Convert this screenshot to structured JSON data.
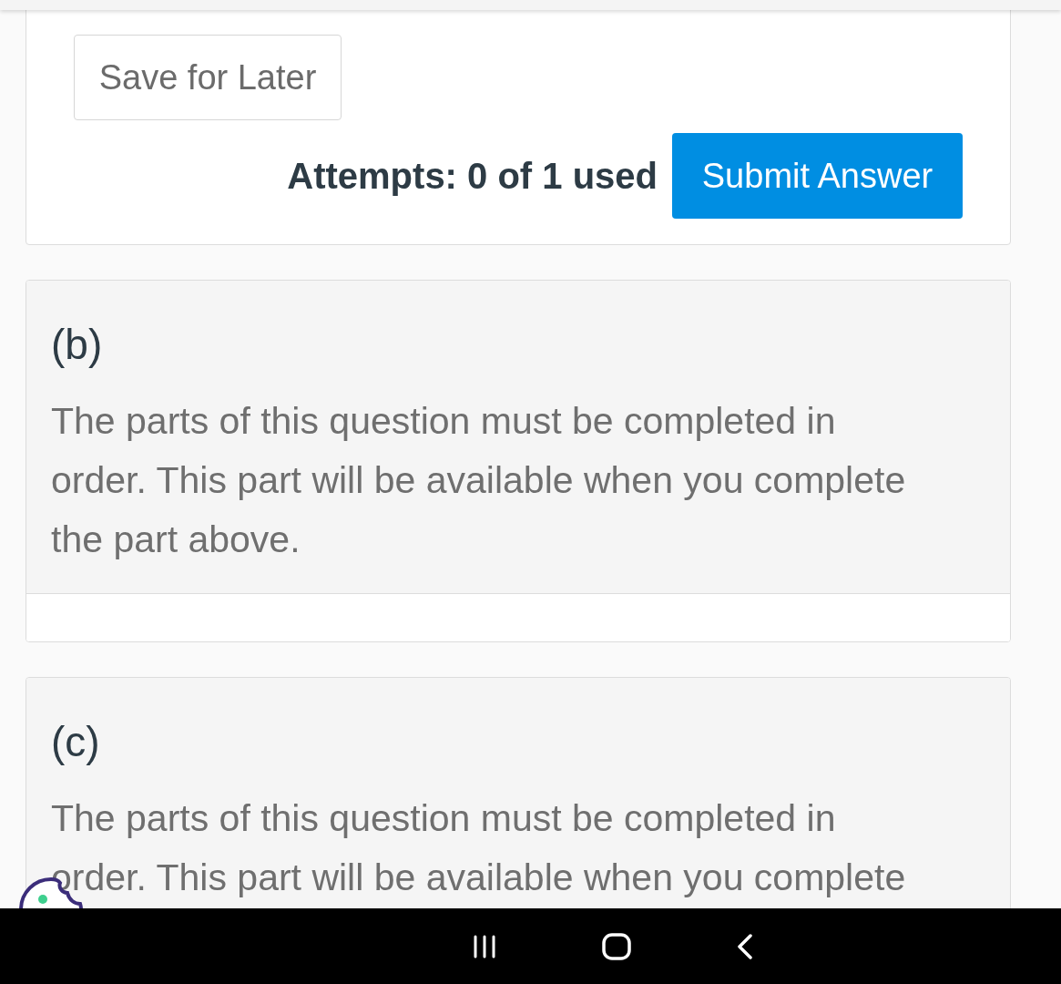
{
  "top_card": {
    "save_button": "Save for Later",
    "attempts": "Attempts: 0 of 1 used",
    "submit_button": "Submit Answer"
  },
  "parts": [
    {
      "label": "(b)",
      "message": "The parts of this question must be completed in order. This part will be available when you complete the part above.",
      "footer": true
    },
    {
      "label": "(c)",
      "message": "The parts of this question must be completed in order. This part will be available when you complete"
    }
  ],
  "nav_bar": {
    "buttons": [
      {
        "kind": "recents"
      },
      {
        "kind": "home"
      },
      {
        "kind": "back"
      }
    ]
  }
}
